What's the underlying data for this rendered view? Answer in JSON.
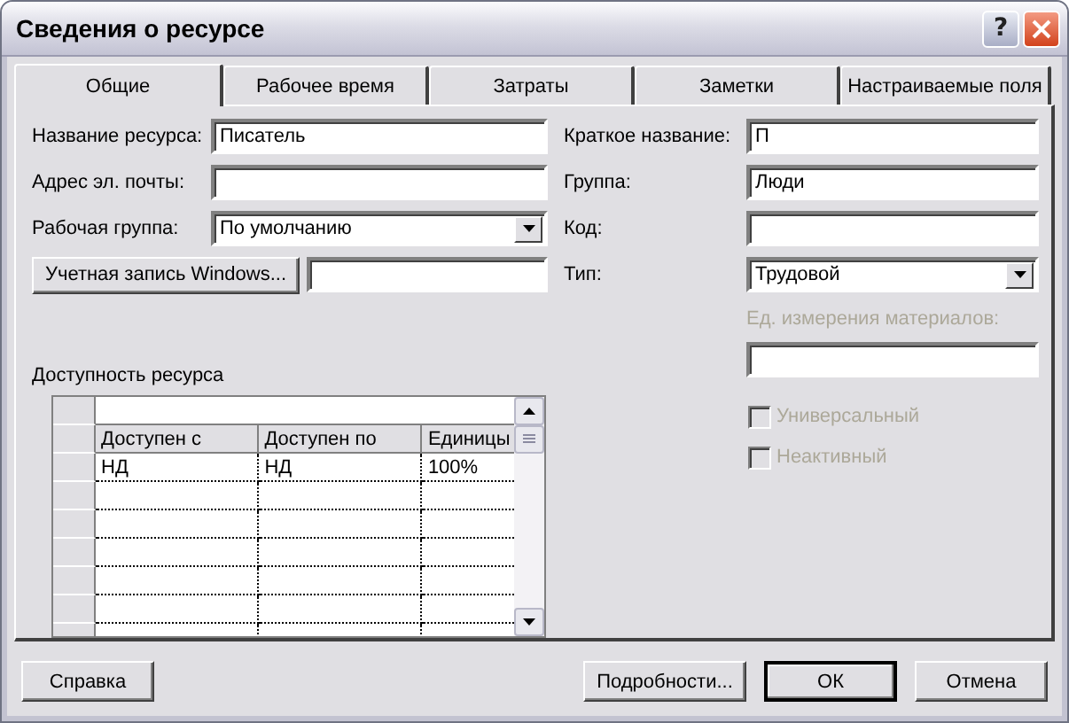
{
  "window": {
    "title": "Сведения о ресурсе",
    "help_button": "?"
  },
  "tabs": [
    {
      "label": "Общие",
      "selected": true
    },
    {
      "label": "Рабочее время",
      "selected": false
    },
    {
      "label": "Затраты",
      "selected": false
    },
    {
      "label": "Заметки",
      "selected": false
    },
    {
      "label": "Настраиваемые поля",
      "selected": false
    }
  ],
  "left_fields": [
    {
      "kind": "text",
      "label": "Название ресурса:",
      "value": "Писатель"
    },
    {
      "kind": "text",
      "label": "Адрес эл. почты:"
    },
    {
      "kind": "combo",
      "label": "Рабочая группа:",
      "value": "По умолчанию"
    },
    {
      "kind": "button",
      "button": "Учетная запись Windows..."
    }
  ],
  "right_fields": [
    {
      "kind": "text",
      "label": "Краткое название:",
      "value": "П",
      "disabled": false
    },
    {
      "kind": "text",
      "label": "Группа:",
      "value": "Люди",
      "disabled": false
    },
    {
      "kind": "text",
      "label": "Код:",
      "disabled": false
    },
    {
      "kind": "combo",
      "label": "Тип:",
      "value": "Трудовой",
      "disabled": false
    },
    {
      "kind": "stacked",
      "label": "Ед. измерения материалов:",
      "disabled": true
    }
  ],
  "checkboxes": [
    {
      "label": "Универсальный",
      "checked": false,
      "disabled": true
    },
    {
      "label": "Неактивный",
      "checked": false,
      "disabled": true
    }
  ],
  "availability": {
    "label": "Доступность ресурса",
    "columns": [
      "Доступен с",
      "Доступен по",
      "Единицы"
    ],
    "rows": [
      [
        "НД",
        "НД",
        "100%"
      ]
    ]
  },
  "buttons": [
    {
      "label": "Справка",
      "default": false
    },
    {
      "label": "Подробности...",
      "default": false
    },
    {
      "label": "ОК",
      "default": true
    },
    {
      "label": "Отмена",
      "default": false
    }
  ]
}
